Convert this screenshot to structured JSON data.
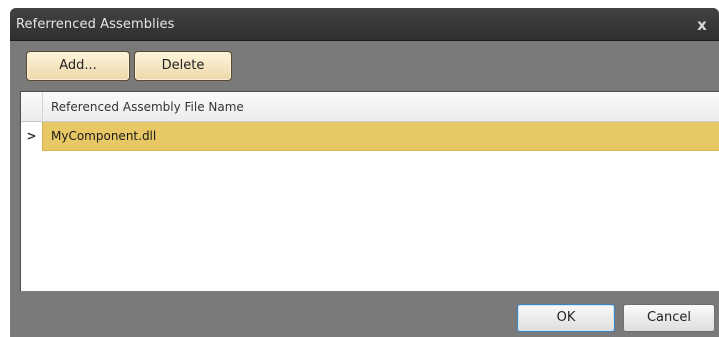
{
  "window": {
    "title": "Referrenced Assemblies",
    "close_label": "x"
  },
  "toolbar": {
    "add_label": "Add...",
    "delete_label": "Delete"
  },
  "grid": {
    "columns": [
      "Referenced Assembly File Name"
    ],
    "rows": [
      {
        "indicator": ">",
        "file_name": "MyComponent.dll",
        "selected": true
      }
    ]
  },
  "footer": {
    "ok_label": "OK",
    "cancel_label": "Cancel"
  },
  "colors": {
    "selected_row": "#e8c765",
    "titlebar": "#3a3a3a",
    "window_body": "#7a7a7a"
  }
}
